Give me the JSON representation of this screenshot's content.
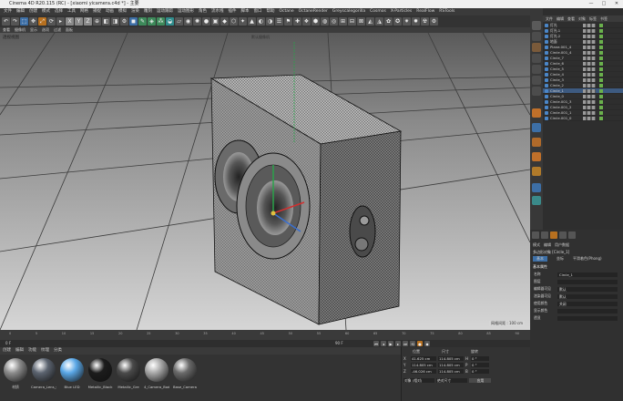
{
  "window": {
    "title": "Cinema 4D R20.115 (RC) - [xiaomi yicamera.c4d *] - 主要",
    "controls": [
      "—",
      "□",
      "✕"
    ]
  },
  "menubar": [
    "文件",
    "编辑",
    "创建",
    "模式",
    "选择",
    "工具",
    "网格",
    "捕捉",
    "动画",
    "模拟",
    "渲染",
    "雕刻",
    "运动跟踪",
    "运动图形",
    "角色",
    "流水线",
    "插件",
    "脚本",
    "窗口",
    "帮助",
    "Octane",
    "OctaneRender",
    "Greyscalegorilla",
    "Cosmos",
    "X-Particles",
    "RealFlow",
    "RSTools"
  ],
  "viewport": {
    "menu": [
      "查看",
      "摄像机",
      "显示",
      "选项",
      "过滤",
      "面板"
    ],
    "mode": "透视视图",
    "camera_label": "默认摄像机",
    "grid_info": "网格间距 : 100 cm"
  },
  "timeline": {
    "ticks": [
      "0",
      "5",
      "10",
      "15",
      "20",
      "25",
      "30",
      "35",
      "40",
      "45",
      "50",
      "55",
      "60",
      "65",
      "70",
      "75",
      "80",
      "85",
      "90"
    ],
    "current_frame": "0 F",
    "start": "0 F",
    "end": "90 F",
    "end2": "90 F"
  },
  "materials": {
    "menu": [
      "创建",
      "编辑",
      "功能",
      "纹理",
      "分类"
    ],
    "items": [
      {
        "label": "材质",
        "color": "#8c8c8c"
      },
      {
        "label": "Camera_Lens_Gl",
        "color": "#5c6470"
      },
      {
        "label": "Blue LED",
        "color": "#5aa7e6"
      },
      {
        "label": "Metallic_Black",
        "color": "#1c1c1c"
      },
      {
        "label": "Metallic_Gre",
        "color": "#4a4a4a"
      },
      {
        "label": "4_Camera_Bod",
        "color": "#a8a8a8"
      },
      {
        "label": "Base_Camera",
        "color": "#6a6a6a"
      }
    ]
  },
  "coordinates": {
    "headers": [
      "位置",
      "尺寸",
      "旋转"
    ],
    "rows": [
      {
        "axis": "X",
        "pos": "41.625 cm",
        "size": "114.805 cm",
        "rot_label": "H",
        "rot": "0 °"
      },
      {
        "axis": "Y",
        "pos": "114.805 cm",
        "size": "114.805 cm",
        "rot_label": "P",
        "rot": "0 °"
      },
      {
        "axis": "Z",
        "pos": "-46.026 cm",
        "size": "114.805 cm",
        "rot_label": "B",
        "rot": "0 °"
      }
    ],
    "mode": "对象 (相对)",
    "size_mode": "绝对尺寸",
    "apply": "应用"
  },
  "object_manager": {
    "menu": [
      "文件",
      "编辑",
      "查看",
      "对象",
      "标签",
      "书签"
    ],
    "objects": [
      "灯光",
      "灯光.1",
      "灯光.2",
      "地面",
      "Plane.001_4",
      "Circle.001_4",
      "Circle_7",
      "Circle_6",
      "Circle_5",
      "Circle_4",
      "Circle_3",
      "Circle_2",
      "Circle_1",
      "Circle_0",
      "Circle.001_3",
      "Circle.001_2",
      "Circle.001_1",
      "Circle.001_0"
    ]
  },
  "attributes": {
    "tabs": [
      "模式",
      "编辑",
      "用户数据"
    ],
    "object_name": "多边形对象 [Circle_1]",
    "sub_tabs": [
      "基本",
      "坐标",
      "平滑着色(Phong)"
    ],
    "section": "基本属性",
    "fields": [
      {
        "label": "名称",
        "value": "Circle_1"
      },
      {
        "label": "图层",
        "value": ""
      },
      {
        "label": "编辑器可见",
        "value": "默认"
      },
      {
        "label": "渲染器可见",
        "value": "默认"
      },
      {
        "label": "使用颜色",
        "value": "关闭"
      },
      {
        "label": "显示颜色",
        "value": ""
      },
      {
        "label": "透显",
        "value": ""
      }
    ]
  },
  "colors": {
    "viewport_bg": "#c9c9c9",
    "accent": "#3d6fa6",
    "panel": "#2e2e2e"
  }
}
